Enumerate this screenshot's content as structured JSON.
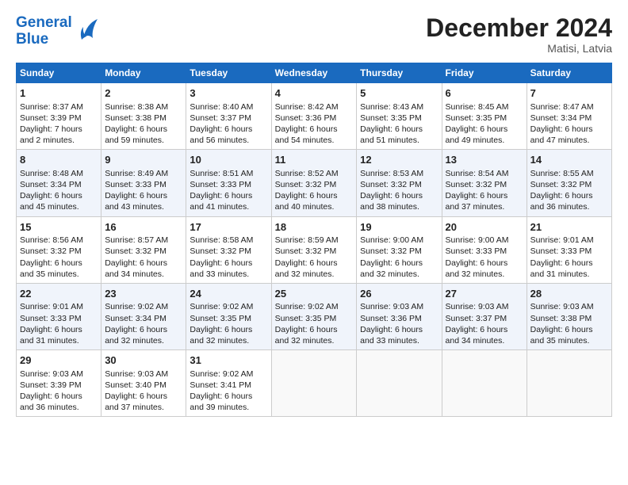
{
  "header": {
    "logo_line1": "General",
    "logo_line2": "Blue",
    "month": "December 2024",
    "location": "Matisi, Latvia"
  },
  "days_of_week": [
    "Sunday",
    "Monday",
    "Tuesday",
    "Wednesday",
    "Thursday",
    "Friday",
    "Saturday"
  ],
  "weeks": [
    [
      {
        "day": "1",
        "sunrise": "Sunrise: 8:37 AM",
        "sunset": "Sunset: 3:39 PM",
        "daylight": "Daylight: 7 hours and 2 minutes."
      },
      {
        "day": "2",
        "sunrise": "Sunrise: 8:38 AM",
        "sunset": "Sunset: 3:38 PM",
        "daylight": "Daylight: 6 hours and 59 minutes."
      },
      {
        "day": "3",
        "sunrise": "Sunrise: 8:40 AM",
        "sunset": "Sunset: 3:37 PM",
        "daylight": "Daylight: 6 hours and 56 minutes."
      },
      {
        "day": "4",
        "sunrise": "Sunrise: 8:42 AM",
        "sunset": "Sunset: 3:36 PM",
        "daylight": "Daylight: 6 hours and 54 minutes."
      },
      {
        "day": "5",
        "sunrise": "Sunrise: 8:43 AM",
        "sunset": "Sunset: 3:35 PM",
        "daylight": "Daylight: 6 hours and 51 minutes."
      },
      {
        "day": "6",
        "sunrise": "Sunrise: 8:45 AM",
        "sunset": "Sunset: 3:35 PM",
        "daylight": "Daylight: 6 hours and 49 minutes."
      },
      {
        "day": "7",
        "sunrise": "Sunrise: 8:47 AM",
        "sunset": "Sunset: 3:34 PM",
        "daylight": "Daylight: 6 hours and 47 minutes."
      }
    ],
    [
      {
        "day": "8",
        "sunrise": "Sunrise: 8:48 AM",
        "sunset": "Sunset: 3:34 PM",
        "daylight": "Daylight: 6 hours and 45 minutes."
      },
      {
        "day": "9",
        "sunrise": "Sunrise: 8:49 AM",
        "sunset": "Sunset: 3:33 PM",
        "daylight": "Daylight: 6 hours and 43 minutes."
      },
      {
        "day": "10",
        "sunrise": "Sunrise: 8:51 AM",
        "sunset": "Sunset: 3:33 PM",
        "daylight": "Daylight: 6 hours and 41 minutes."
      },
      {
        "day": "11",
        "sunrise": "Sunrise: 8:52 AM",
        "sunset": "Sunset: 3:32 PM",
        "daylight": "Daylight: 6 hours and 40 minutes."
      },
      {
        "day": "12",
        "sunrise": "Sunrise: 8:53 AM",
        "sunset": "Sunset: 3:32 PM",
        "daylight": "Daylight: 6 hours and 38 minutes."
      },
      {
        "day": "13",
        "sunrise": "Sunrise: 8:54 AM",
        "sunset": "Sunset: 3:32 PM",
        "daylight": "Daylight: 6 hours and 37 minutes."
      },
      {
        "day": "14",
        "sunrise": "Sunrise: 8:55 AM",
        "sunset": "Sunset: 3:32 PM",
        "daylight": "Daylight: 6 hours and 36 minutes."
      }
    ],
    [
      {
        "day": "15",
        "sunrise": "Sunrise: 8:56 AM",
        "sunset": "Sunset: 3:32 PM",
        "daylight": "Daylight: 6 hours and 35 minutes."
      },
      {
        "day": "16",
        "sunrise": "Sunrise: 8:57 AM",
        "sunset": "Sunset: 3:32 PM",
        "daylight": "Daylight: 6 hours and 34 minutes."
      },
      {
        "day": "17",
        "sunrise": "Sunrise: 8:58 AM",
        "sunset": "Sunset: 3:32 PM",
        "daylight": "Daylight: 6 hours and 33 minutes."
      },
      {
        "day": "18",
        "sunrise": "Sunrise: 8:59 AM",
        "sunset": "Sunset: 3:32 PM",
        "daylight": "Daylight: 6 hours and 32 minutes."
      },
      {
        "day": "19",
        "sunrise": "Sunrise: 9:00 AM",
        "sunset": "Sunset: 3:32 PM",
        "daylight": "Daylight: 6 hours and 32 minutes."
      },
      {
        "day": "20",
        "sunrise": "Sunrise: 9:00 AM",
        "sunset": "Sunset: 3:33 PM",
        "daylight": "Daylight: 6 hours and 32 minutes."
      },
      {
        "day": "21",
        "sunrise": "Sunrise: 9:01 AM",
        "sunset": "Sunset: 3:33 PM",
        "daylight": "Daylight: 6 hours and 31 minutes."
      }
    ],
    [
      {
        "day": "22",
        "sunrise": "Sunrise: 9:01 AM",
        "sunset": "Sunset: 3:33 PM",
        "daylight": "Daylight: 6 hours and 31 minutes."
      },
      {
        "day": "23",
        "sunrise": "Sunrise: 9:02 AM",
        "sunset": "Sunset: 3:34 PM",
        "daylight": "Daylight: 6 hours and 32 minutes."
      },
      {
        "day": "24",
        "sunrise": "Sunrise: 9:02 AM",
        "sunset": "Sunset: 3:35 PM",
        "daylight": "Daylight: 6 hours and 32 minutes."
      },
      {
        "day": "25",
        "sunrise": "Sunrise: 9:02 AM",
        "sunset": "Sunset: 3:35 PM",
        "daylight": "Daylight: 6 hours and 32 minutes."
      },
      {
        "day": "26",
        "sunrise": "Sunrise: 9:03 AM",
        "sunset": "Sunset: 3:36 PM",
        "daylight": "Daylight: 6 hours and 33 minutes."
      },
      {
        "day": "27",
        "sunrise": "Sunrise: 9:03 AM",
        "sunset": "Sunset: 3:37 PM",
        "daylight": "Daylight: 6 hours and 34 minutes."
      },
      {
        "day": "28",
        "sunrise": "Sunrise: 9:03 AM",
        "sunset": "Sunset: 3:38 PM",
        "daylight": "Daylight: 6 hours and 35 minutes."
      }
    ],
    [
      {
        "day": "29",
        "sunrise": "Sunrise: 9:03 AM",
        "sunset": "Sunset: 3:39 PM",
        "daylight": "Daylight: 6 hours and 36 minutes."
      },
      {
        "day": "30",
        "sunrise": "Sunrise: 9:03 AM",
        "sunset": "Sunset: 3:40 PM",
        "daylight": "Daylight: 6 hours and 37 minutes."
      },
      {
        "day": "31",
        "sunrise": "Sunrise: 9:02 AM",
        "sunset": "Sunset: 3:41 PM",
        "daylight": "Daylight: 6 hours and 39 minutes."
      },
      {
        "day": "",
        "sunrise": "",
        "sunset": "",
        "daylight": ""
      },
      {
        "day": "",
        "sunrise": "",
        "sunset": "",
        "daylight": ""
      },
      {
        "day": "",
        "sunrise": "",
        "sunset": "",
        "daylight": ""
      },
      {
        "day": "",
        "sunrise": "",
        "sunset": "",
        "daylight": ""
      }
    ]
  ]
}
